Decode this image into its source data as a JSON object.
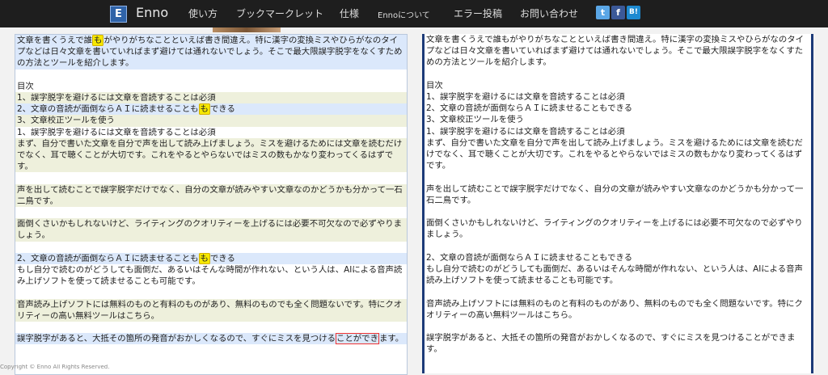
{
  "header": {
    "logo_letter": "E",
    "logo_text": "Enno",
    "nav": [
      "使い方",
      "ブックマークレット",
      "仕様",
      "Ennoについて",
      "エラー投稿",
      "お問い合わせ"
    ],
    "social": [
      "t",
      "f",
      "B!"
    ],
    "colors": {
      "twitter": "#5aa6e6",
      "facebook": "#3b5998",
      "hatena": "#1d8ad1"
    }
  },
  "left": {
    "p0_pre": "文章を書くうえで誰",
    "p0_hl": "も",
    "p0_post": "がやりがちなことといえば書き間違え。特に漢字の変換ミスやひらがなのタイプなどは日々文章を書いていればまず避けては通れないでしょう。そこで最大限誤字脱字をなくすための方法とツールを紹介します。",
    "toc": "目次",
    "toc1": "1、誤字脱字を避けるには文章を音読することは必須",
    "toc2_pre": "2、文章の音読が面倒ならＡＩに読ませることも",
    "toc2_hl": "も",
    "toc2_post": "できる",
    "toc3": "3、文章校正ツールを使う",
    "h1": "1、誤字脱字を避けるには文章を音読することは必須",
    "p1": "まず、自分で書いた文章を自分で声を出して読み上げましょう。ミスを避けるためには文章を読むだけでなく、耳で聴くことが大切です。これをやるとやらないではミスの数もかなり変わってくるはずです。",
    "p2": "声を出して読むことで誤字脱字だけでなく、自分の文章が読みやすい文章なのかどうかも分かって一石二鳥です。",
    "p3": "面倒くさいかもしれないけど、ライティングのクオリティーを上げるには必要不可欠なので必ずやりましょう。",
    "h2_pre": "2、文章の音読が面倒ならＡＩに読ませることも",
    "h2_hl": "も",
    "h2_post": "できる",
    "p4": "もし自分で読むのがどうしても面倒だ、あるいはそんな時間が作れない、という人は、AIによる音声読み上げソフトを使って読ませることも可能です。",
    "p5": "音声読み上げソフトには無料のものと有料のものがあり、無料のものでも全く問題ないです。特にクオリティーの高い無料ツールはこちら。",
    "p6_pre": "誤字脱字があると、大抵その箇所の発音がおかしくなるので、すぐにミスを見つける",
    "p6_box": "ことができ",
    "p6_post": "ます。"
  },
  "right": {
    "p0": "文章を書くうえで誰もがやりがちなことといえば書き間違え。特に漢字の変換ミスやひらがなのタイプなどは日々文章を書いていればまず避けては通れないでしょう。そこで最大限誤字脱字をなくすための方法とツールを紹介します。",
    "toc": "目次",
    "toc1": "1、誤字脱字を避けるには文章を音読することは必須",
    "toc2": "2、文章の音読が面倒ならＡＩに読ませることもできる",
    "toc3": "3、文章校正ツールを使う",
    "h1": "1、誤字脱字を避けるには文章を音読することは必須",
    "p1": "まず、自分で書いた文章を自分で声を出して読み上げましょう。ミスを避けるためには文章を読むだけでなく、耳で聴くことが大切です。これをやるとやらないではミスの数もかなり変わってくるはずです。",
    "p2": "声を出して読むことで誤字脱字だけでなく、自分の文章が読みやすい文章なのかどうかも分かって一石二鳥です。",
    "p3": "面倒くさいかもしれないけど、ライティングのクオリティーを上げるには必要不可欠なので必ずやりましょう。",
    "h2": "2、文章の音読が面倒ならＡＩに読ませることもできる",
    "p4": "もし自分で読むのがどうしても面倒だ、あるいはそんな時間が作れない、という人は、AIによる音声読み上げソフトを使って読ませることも可能です。",
    "p5": "音声読み上げソフトには無料のものと有料のものがあり、無料のものでも全く問題ないです。特にクオリティーの高い無料ツールはこちら。",
    "p6": "誤字脱字があると、大抵その箇所の発音がおかしくなるので、すぐにミスを見つけることができます。"
  },
  "footer": "Copyright © Enno All Rights Reserved."
}
